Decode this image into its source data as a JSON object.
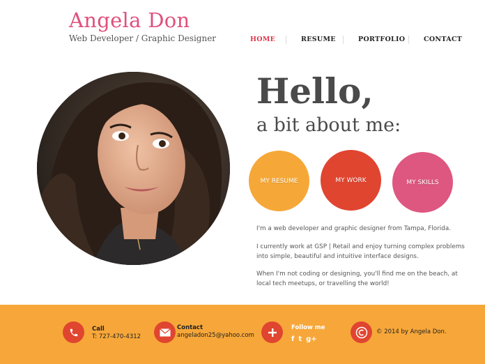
{
  "header": {
    "name": "Angela Don",
    "tagline": "Web Developer / Graphic Designer"
  },
  "nav": {
    "items": [
      {
        "label": "HOME",
        "active": true
      },
      {
        "label": "RESUME",
        "active": false
      },
      {
        "label": "PORTFOLIO",
        "active": false
      },
      {
        "label": "CONTACT",
        "active": false
      }
    ]
  },
  "hero": {
    "greeting": "Hello,",
    "subheading": "a bit about me:"
  },
  "circle_buttons": [
    {
      "label": "MY RESUME",
      "color": "#f5a838"
    },
    {
      "label": "MY WORK",
      "color": "#e04530"
    },
    {
      "label": "MY SKILLS",
      "color": "#de5780"
    }
  ],
  "bio": [
    "I'm a web developer and graphic designer from Tampa, Florida.",
    "I currently work at GSP | Retail and enjoy turning complex problems into simple, beautiful and intuitive interface designs.",
    "When I'm not coding or designing, you'll find me on the beach, at local tech meetups, or travelling the world!"
  ],
  "footer": {
    "call": {
      "label": "Call",
      "value": "T: 727-470-4312",
      "icon": "phone-icon"
    },
    "contact": {
      "label": "Contact",
      "value": "angeladon25@yahoo.com",
      "icon": "envelope-icon"
    },
    "follow": {
      "label": "Follow me",
      "icon": "plus-icon",
      "social": [
        "f",
        "t",
        "g+"
      ]
    },
    "copyright": {
      "text": "© 2014 by Angela Don.",
      "icon": "copyright-icon"
    }
  },
  "colors": {
    "brand_pink": "#e0507e",
    "footer_bg": "#f7a739",
    "accent_red": "#e04530",
    "nav_active": "#e0364a"
  }
}
